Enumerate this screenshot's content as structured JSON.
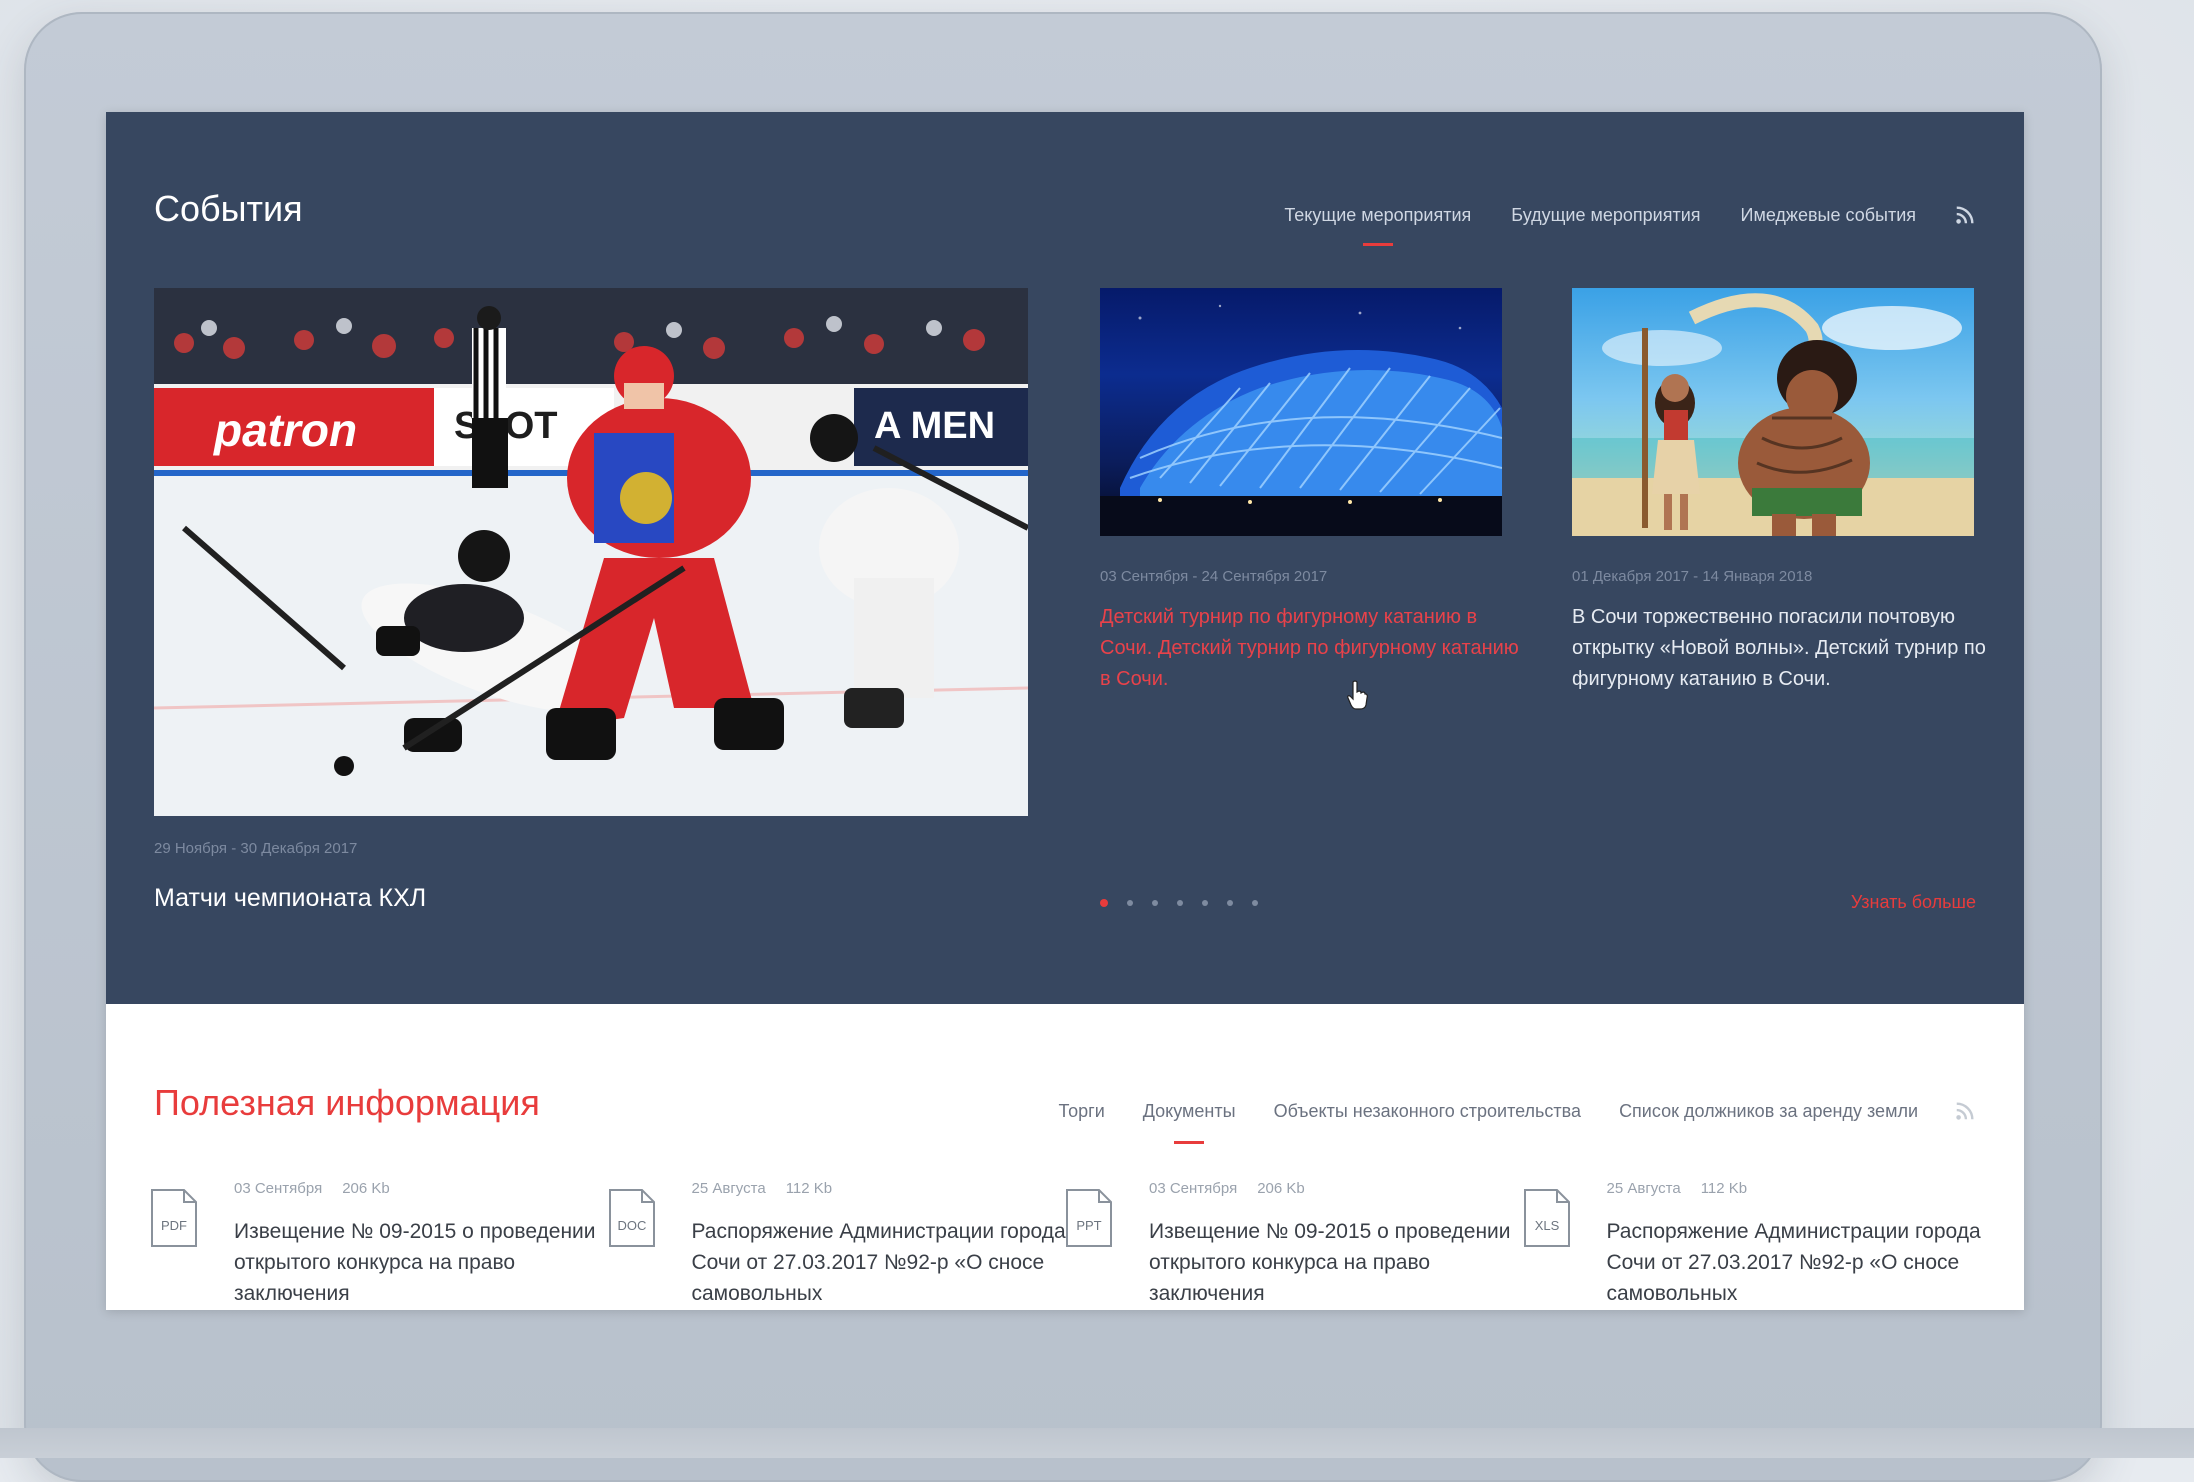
{
  "events": {
    "title": "События",
    "tabs": [
      "Текущие мероприятия",
      "Будущие мероприятия",
      "Имеджевые события"
    ],
    "hero": {
      "date": "29 Ноября - 30 Декабря 2017",
      "caption": "Матчи чемпионата КХЛ",
      "banner_text_1": "patron",
      "banner_text_2": "SSOT",
      "banner_text_3": "A MEN"
    },
    "cards": [
      {
        "date": "03 Сентября - 24 Сентября 2017",
        "text": "Детский турнир по фигурному катанию в Сочи. Детский турнир по фигурному катанию в Сочи."
      },
      {
        "date": "01 Декабря 2017 - 14 Января 2018",
        "text": "В Сочи торжественно погасили почтовую открытку «Новой волны». Детский турнир по фигурному катанию в Сочи."
      }
    ],
    "more_label": "Узнать больше"
  },
  "info": {
    "title": "Полезная информация",
    "tabs": [
      "Торги",
      "Документы",
      "Объекты незаконного строительства",
      "Список должников за аренду земли"
    ],
    "docs": [
      {
        "type": "PDF",
        "date": "03 Сентября",
        "size": "206 Kb",
        "text": "Извещение № 09-2015 о проведении открытого конкурса на право заключения"
      },
      {
        "type": "DOC",
        "date": "25 Августа",
        "size": "112 Kb",
        "text": "Распоряжение Администрации города Сочи от 27.03.2017 №92-р «О сносе самовольных"
      },
      {
        "type": "PPT",
        "date": "03 Сентября",
        "size": "206 Kb",
        "text": "Извещение № 09-2015 о проведении открытого конкурса на право заключения"
      },
      {
        "type": "XLS",
        "date": "25 Августа",
        "size": "112 Kb",
        "text": "Распоряжение Администрации города Сочи от 27.03.2017 №92-р «О сносе самовольных"
      }
    ]
  },
  "colors": {
    "accent": "#e83c3c",
    "events_bg": "#374760"
  },
  "icons": [
    "rss-icon",
    "document-icon",
    "hand-pointer-icon"
  ]
}
